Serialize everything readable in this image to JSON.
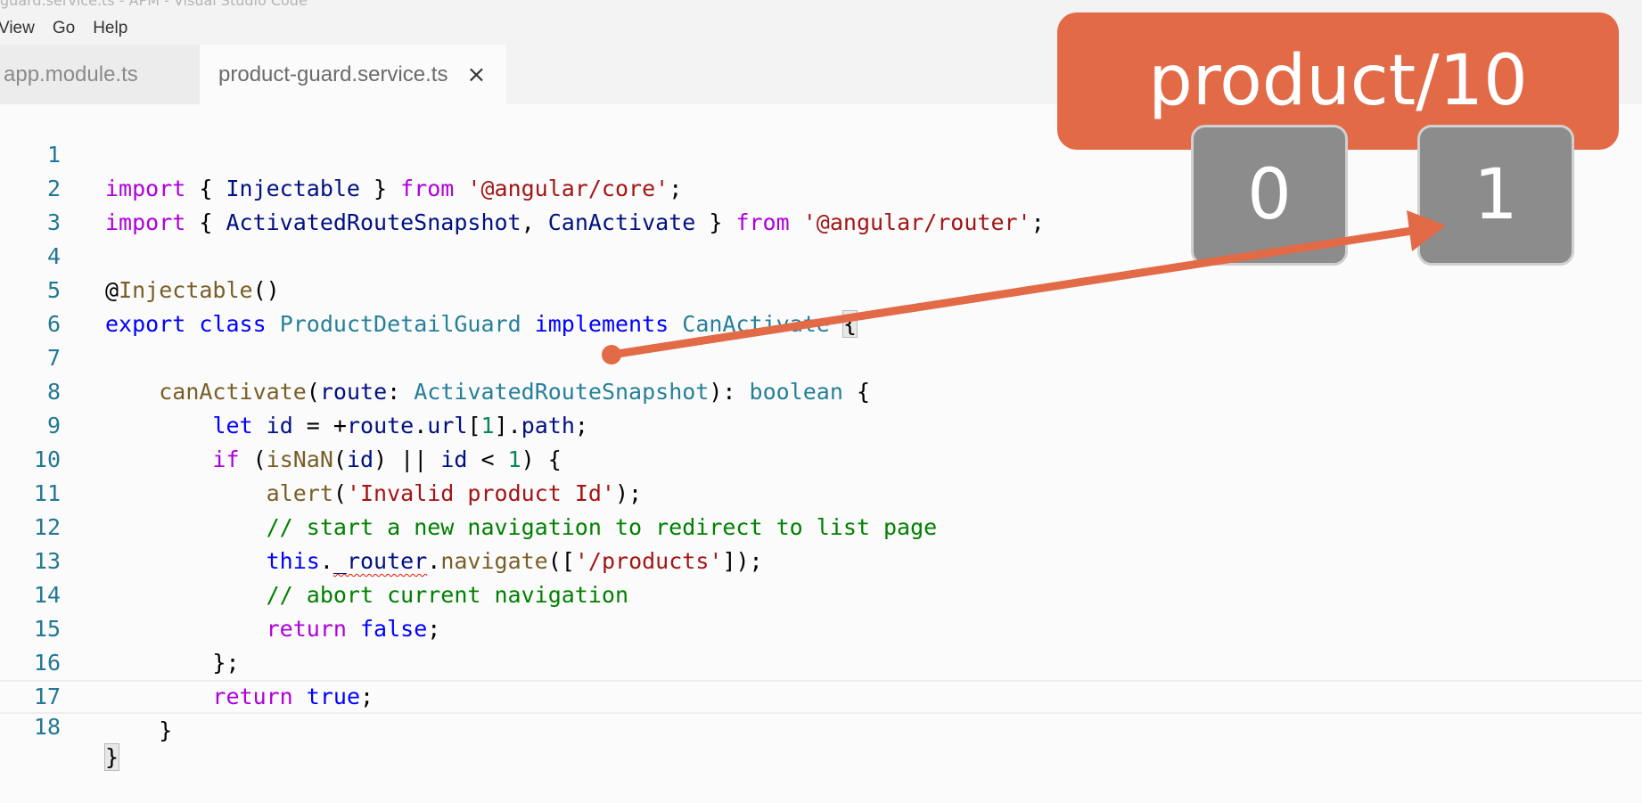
{
  "window": {
    "title": "guard.service.ts - APM - Visual Studio Code"
  },
  "menu": {
    "items": [
      "View",
      "Go",
      "Help"
    ]
  },
  "tabs": [
    {
      "label": "app.module.ts",
      "active": false
    },
    {
      "label": "product-guard.service.ts",
      "active": true,
      "close": "×"
    }
  ],
  "editor": {
    "line_numbers": [
      "1",
      "2",
      "3",
      "4",
      "5",
      "6",
      "7",
      "8",
      "9",
      "10",
      "11",
      "12",
      "13",
      "14",
      "15",
      "16",
      "17",
      "18"
    ],
    "colors": {
      "keyword": "#0000ff",
      "control": "#af00db",
      "string": "#a31515",
      "type": "#267f99",
      "comment": "#008000",
      "line_number": "#237893"
    }
  },
  "annotation": {
    "url": "product/10",
    "segments": [
      "0",
      "1"
    ],
    "accent_color": "#e26a46",
    "segment_color": "#8c8c8c"
  }
}
